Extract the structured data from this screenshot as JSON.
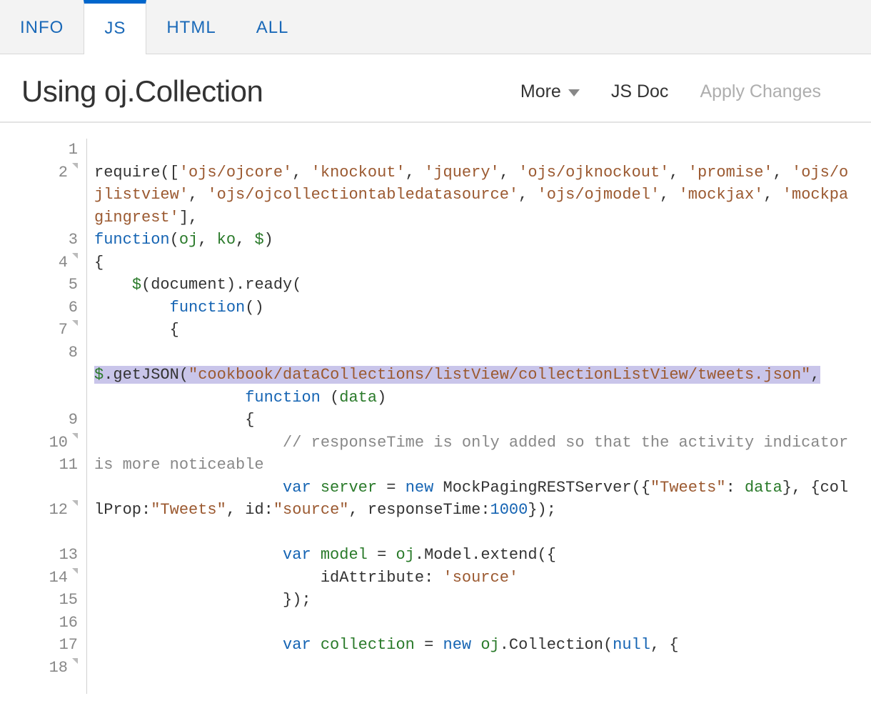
{
  "tabs": [
    {
      "label": "INFO",
      "active": false
    },
    {
      "label": "JS",
      "active": true
    },
    {
      "label": "HTML",
      "active": false
    },
    {
      "label": "ALL",
      "active": false
    }
  ],
  "header": {
    "title": "Using oj.Collection",
    "more_label": "More",
    "jsdoc_label": "JS Doc",
    "apply_label": "Apply Changes"
  },
  "code": {
    "line_numbers": [
      "1",
      "2",
      "3",
      "4",
      "5",
      "6",
      "7",
      "8",
      "9",
      "10",
      "11",
      "12",
      "13",
      "14",
      "15",
      "16",
      "17",
      "18"
    ],
    "fold_lines": [
      "2",
      "4",
      "7",
      "10",
      "12",
      "14",
      "18"
    ],
    "modules": [
      "ojs/ojcore",
      "knockout",
      "jquery",
      "ojs/ojknockout",
      "promise",
      "ojs/ojlistview",
      "ojs/ojcollectiontabledatasource",
      "ojs/ojmodel",
      "mockjax",
      "mockpagingrest"
    ],
    "json_path": "cookbook/dataCollections/listView/collectionListView/tweets.json",
    "comment": "// responseTime is only added so that the activity indicator is more noticeable",
    "server_opts": {
      "key1": "Tweets",
      "collProp": "Tweets",
      "idValue": "source",
      "responseTime": 1000
    },
    "model_id_attr": "source",
    "tokens": {
      "require": "require",
      "function": "function",
      "var": "var",
      "new": "new",
      "null": "null",
      "args": {
        "oj": "oj",
        "ko": "ko",
        "dollar": "$",
        "data": "data",
        "server": "server",
        "model": "model",
        "collection": "collection"
      },
      "ids": {
        "document": "document",
        "ready": "ready",
        "getJSON": "getJSON",
        "MockPagingRESTServer": "MockPagingRESTServer",
        "collProp": "collProp",
        "id": "id",
        "responseTime": "responseTime",
        "Model": "Model",
        "extend": "extend",
        "idAttribute": "idAttribute",
        "Collection": "Collection"
      }
    }
  }
}
